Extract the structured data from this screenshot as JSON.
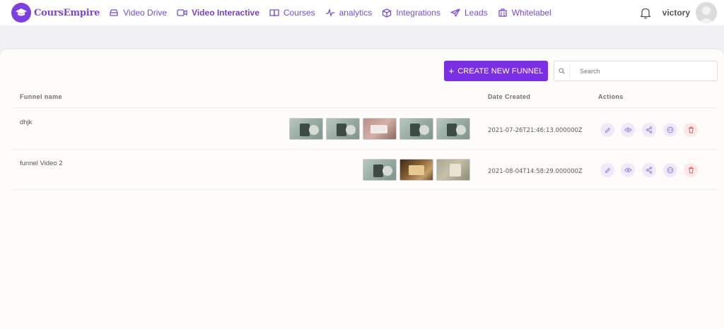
{
  "brand": {
    "name": "CoursEmpire"
  },
  "nav": {
    "items": [
      {
        "label": "Video Drive",
        "icon": "drive-icon"
      },
      {
        "label": "Video Interactive",
        "icon": "video-camera-icon"
      },
      {
        "label": "Courses",
        "icon": "book-icon"
      },
      {
        "label": "analytics",
        "icon": "analytics-icon"
      },
      {
        "label": "Integrations",
        "icon": "cube-icon"
      },
      {
        "label": "Leads",
        "icon": "send-icon"
      },
      {
        "label": "Whitelabel",
        "icon": "building-icon"
      }
    ],
    "active": "Video Interactive"
  },
  "user": {
    "name": "victory"
  },
  "toolbar": {
    "create_label": "CREATE NEW FUNNEL",
    "create_icon": "+",
    "search_placeholder": "Search"
  },
  "table": {
    "headers": {
      "name": "Funnel name",
      "date": "Date Created",
      "actions": "Actions"
    },
    "rows": [
      {
        "name": "dhjk",
        "thumbnails": [
          "green",
          "green",
          "pink",
          "green",
          "green"
        ],
        "date": "2021-07-26T21:46:13.000000Z"
      },
      {
        "name": "funnel Video 2",
        "thumbnails": [
          "green",
          "brown",
          "tan"
        ],
        "date": "2021-08-04T14:58:29.000000Z"
      }
    ],
    "actions": [
      "edit-icon",
      "view-icon",
      "share-icon",
      "embed-icon",
      "delete-icon"
    ]
  },
  "colors": {
    "accent": "#7b2fe3",
    "brand": "#7c3fe0",
    "nav_text": "#7b4bd8",
    "delete": "#e05555"
  }
}
